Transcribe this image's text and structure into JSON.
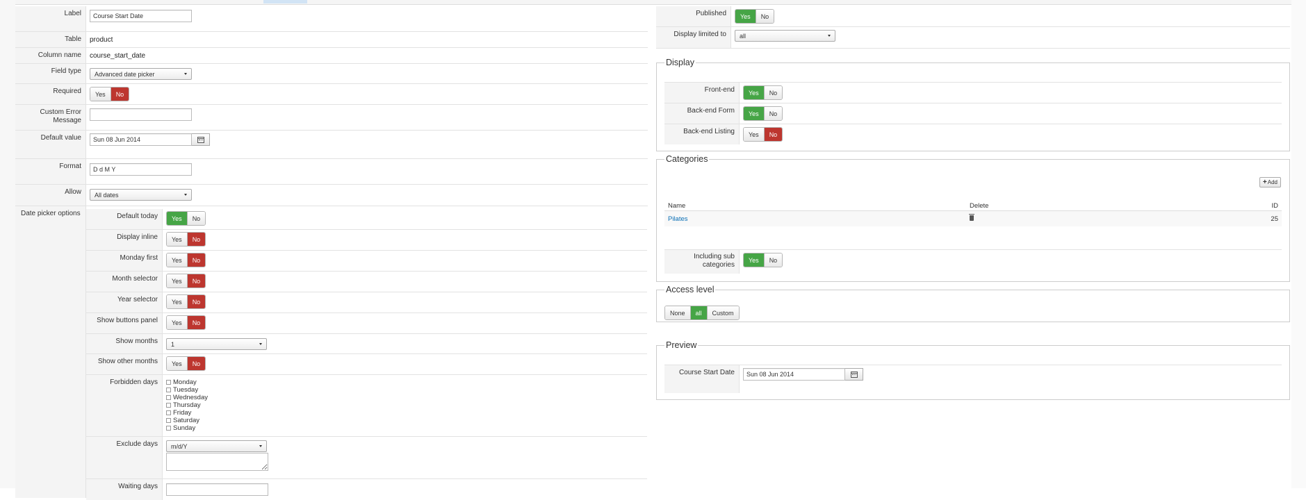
{
  "left": {
    "label": {
      "label": "Label",
      "value": "Course Start Date"
    },
    "table": {
      "label": "Table",
      "value": "product"
    },
    "column_name": {
      "label": "Column name",
      "value": "course_start_date"
    },
    "field_type": {
      "label": "Field type",
      "value": "Advanced date picker"
    },
    "required": {
      "label": "Required",
      "yes": "Yes",
      "no": "No",
      "selected": "no"
    },
    "custom_error": {
      "label": "Custom Error Message",
      "value": ""
    },
    "default_value": {
      "label": "Default value",
      "value": "Sun 08 Jun 2014"
    },
    "format": {
      "label": "Format",
      "value": "D d M Y"
    },
    "allow": {
      "label": "Allow",
      "value": "All dates"
    },
    "date_picker_options": {
      "label": "Date picker options"
    }
  },
  "options": {
    "default_today": {
      "label": "Default today",
      "yes": "Yes",
      "no": "No",
      "selected": "yes"
    },
    "display_inline": {
      "label": "Display inline",
      "yes": "Yes",
      "no": "No",
      "selected": "no"
    },
    "monday_first": {
      "label": "Monday first",
      "yes": "Yes",
      "no": "No",
      "selected": "no"
    },
    "month_selector": {
      "label": "Month selector",
      "yes": "Yes",
      "no": "No",
      "selected": "no"
    },
    "year_selector": {
      "label": "Year selector",
      "yes": "Yes",
      "no": "No",
      "selected": "no"
    },
    "show_buttons_panel": {
      "label": "Show buttons panel",
      "yes": "Yes",
      "no": "No",
      "selected": "no"
    },
    "show_months": {
      "label": "Show months",
      "value": "1"
    },
    "show_other_months": {
      "label": "Show other months",
      "yes": "Yes",
      "no": "No",
      "selected": "no"
    },
    "forbidden_days": {
      "label": "Forbidden days",
      "days": [
        "Monday",
        "Tuesday",
        "Wednesday",
        "Thursday",
        "Friday",
        "Saturday",
        "Sunday"
      ]
    },
    "exclude_days": {
      "label": "Exclude days",
      "value": "m/d/Y",
      "text": ""
    },
    "waiting_days": {
      "label": "Waiting days",
      "value": ""
    }
  },
  "right": {
    "published": {
      "label": "Published",
      "yes": "Yes",
      "no": "No",
      "selected": "yes"
    },
    "display_limited": {
      "label": "Display limited to",
      "value": "all"
    },
    "display": {
      "legend": "Display",
      "frontend": {
        "label": "Front-end",
        "yes": "Yes",
        "no": "No",
        "selected": "yes"
      },
      "backend_form": {
        "label": "Back-end Form",
        "yes": "Yes",
        "no": "No",
        "selected": "yes"
      },
      "backend_listing": {
        "label": "Back-end Listing",
        "yes": "Yes",
        "no": "No",
        "selected": "no"
      }
    },
    "categories": {
      "legend": "Categories",
      "add_label": "Add",
      "columns": {
        "name": "Name",
        "delete": "Delete",
        "id": "ID"
      },
      "rows": [
        {
          "name": "Pilates",
          "id": "25"
        }
      ],
      "including_sub": {
        "label": "Including sub categories",
        "yes": "Yes",
        "no": "No",
        "selected": "yes"
      }
    },
    "access": {
      "legend": "Access level",
      "options": [
        "None",
        "all",
        "Custom"
      ],
      "selected": "all"
    },
    "preview": {
      "legend": "Preview",
      "label": "Course Start Date",
      "value": "Sun 08 Jun 2014"
    }
  }
}
